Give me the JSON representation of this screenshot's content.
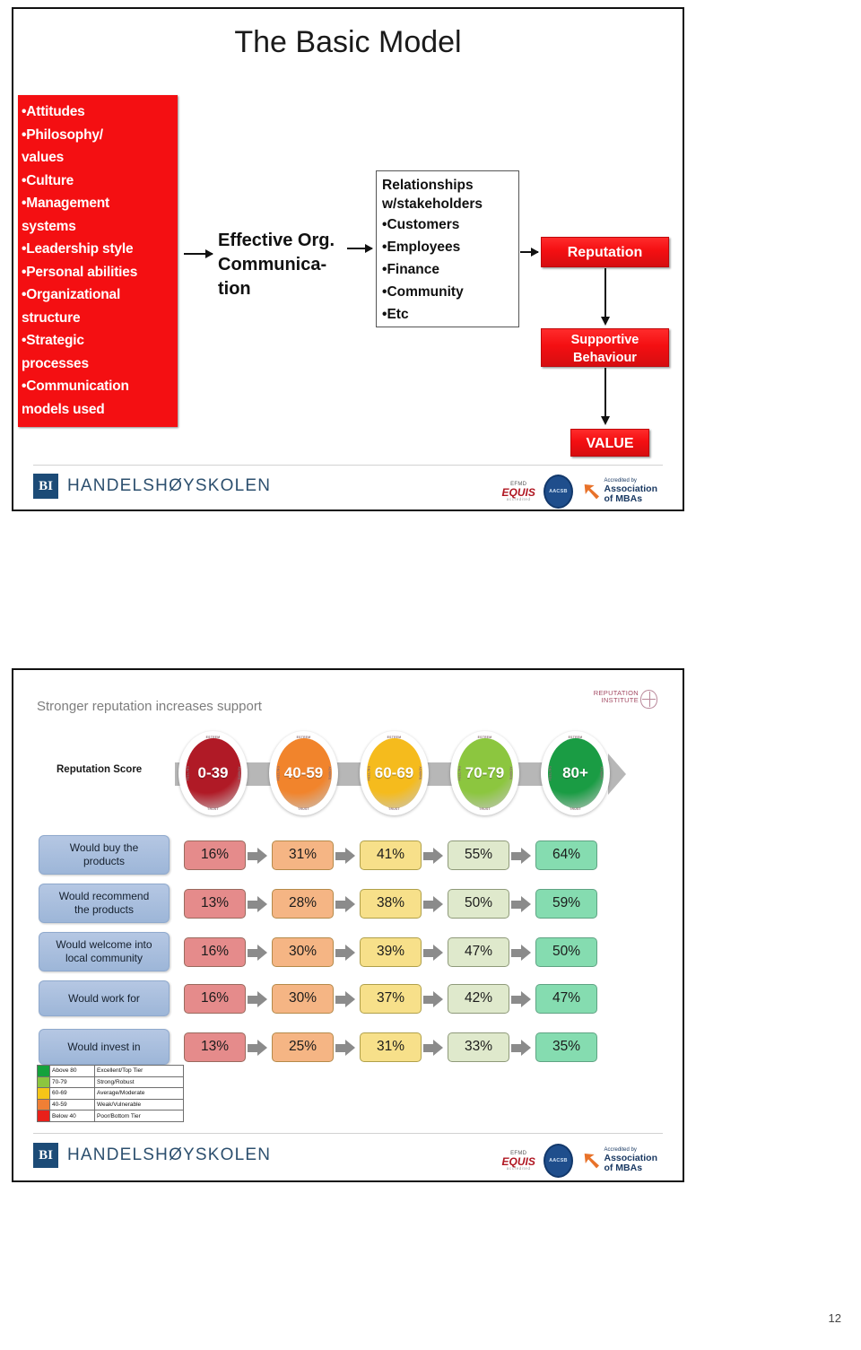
{
  "slide1": {
    "title": "The Basic Model",
    "inputs_panel": {
      "name": "drivers-list",
      "items": [
        "Attitudes",
        "Philosophy/",
        "values",
        "Culture",
        "Management",
        "systems",
        "Leadership style",
        "Personal abilities",
        "Organizational",
        "structure",
        "Strategic",
        "processes",
        "Communication",
        "models used"
      ],
      "continuation_lines": [
        2,
        5,
        9,
        11,
        13
      ],
      "color": "#f40f12"
    },
    "effective_comm": {
      "line1": "Effective  Org.",
      "line2": "Communica-",
      "line3": "tion"
    },
    "relationships_box": {
      "heading_line1": "Relationships",
      "heading_line2": "w/stakeholders",
      "bullets": [
        "Customers",
        "Employees",
        "Finance",
        "Community",
        "Etc"
      ]
    },
    "outcome_boxes": {
      "reputation": "Reputation",
      "supportive_line1": "Supportive",
      "supportive_line2": "Behaviour",
      "value": "VALUE"
    },
    "footer": {
      "bi_mark": "BI",
      "bi_word": "HANDELSHØYSKOLEN",
      "equis_efmd": "EFMD",
      "equis_name": "EQUIS",
      "equis_sub": "accredited",
      "aacsb": "AACSB",
      "amba_line1": "Accredited by",
      "amba_line2": "Association",
      "amba_line3": "of MBAs"
    }
  },
  "slide2": {
    "title": "Stronger reputation increases support",
    "logo": {
      "line1": "REPUTATION",
      "line2": "INSTITUTE"
    },
    "score_row_label": "Reputation Score",
    "oval_captions": {
      "top": "ESTEEM",
      "left": "FEELING",
      "right": "ADMIRE",
      "bottom": "TRUST"
    },
    "legend_rows": [
      {
        "range": "Above 80",
        "desc": "Excellent/Top Tier",
        "color": "#15a23c"
      },
      {
        "range": "70-79",
        "desc": "Strong/Robust",
        "color": "#8cc63f"
      },
      {
        "range": "60-69",
        "desc": "Average/Moderate",
        "color": "#f5c518"
      },
      {
        "range": "40-59",
        "desc": "Weak/Vulnerable",
        "color": "#f07f35"
      },
      {
        "range": "Below 40",
        "desc": "Poor/Bottom Tier",
        "color": "#e8201a"
      }
    ],
    "chart_data": {
      "type": "heatmap",
      "title": "Stronger reputation increases support",
      "xlabel": "Reputation Score",
      "ylabel": "",
      "categories": [
        "0-39",
        "40-59",
        "60-69",
        "70-79",
        "80+"
      ],
      "category_colors": [
        "#b01a26",
        "#f1842c",
        "#f5bb1d",
        "#8cc63f",
        "#1a9c44"
      ],
      "cell_colors": [
        "#e58b8b",
        "#f5b584",
        "#f7e08a",
        "#dfe9cc",
        "#85dcb0"
      ],
      "cell_borders": [
        "#9a6a5e",
        "#b58a4a",
        "#b0a04a",
        "#8f9a7a",
        "#5fa383"
      ],
      "series": [
        {
          "name": "Would buy the products",
          "values": [
            "16%",
            "31%",
            "41%",
            "55%",
            "64%"
          ]
        },
        {
          "name": "Would recommend the products",
          "values": [
            "13%",
            "28%",
            "38%",
            "50%",
            "59%"
          ]
        },
        {
          "name": "Would welcome into local community",
          "values": [
            "16%",
            "30%",
            "39%",
            "47%",
            "50%"
          ]
        },
        {
          "name": "Would work for",
          "values": [
            "16%",
            "30%",
            "37%",
            "42%",
            "47%"
          ]
        },
        {
          "name": "Would invest in",
          "values": [
            "13%",
            "25%",
            "31%",
            "33%",
            "35%"
          ]
        }
      ],
      "row_labels": [
        [
          "Would buy the",
          "products"
        ],
        [
          "Would recommend",
          "the products"
        ],
        [
          "Would welcome into",
          "local community"
        ],
        [
          "Would work for",
          ""
        ],
        [
          "Would invest in",
          ""
        ]
      ],
      "legend_position": "bottom-left",
      "grid": false
    },
    "footer": {
      "bi_mark": "BI",
      "bi_word": "HANDELSHØYSKOLEN",
      "equis_efmd": "EFMD",
      "equis_name": "EQUIS",
      "equis_sub": "accredited",
      "aacsb": "AACSB",
      "amba_line1": "Accredited by",
      "amba_line2": "Association",
      "amba_line3": "of MBAs"
    }
  },
  "page_number": "12"
}
